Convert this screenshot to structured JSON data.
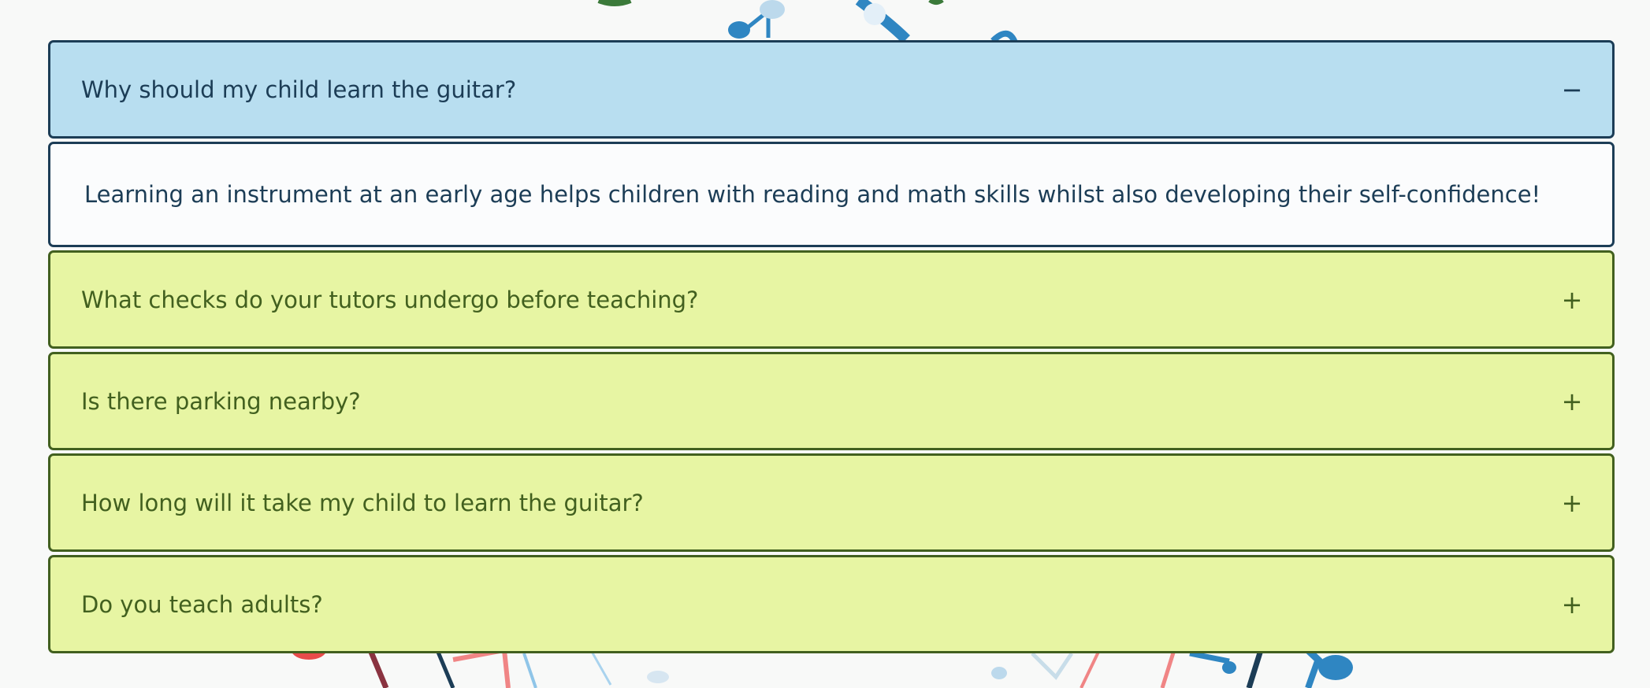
{
  "faq": {
    "items": [
      {
        "question": "Why should my child learn the guitar?",
        "toggle": "−",
        "answer": "Learning an instrument at an early age helps children with reading and math skills whilst also developing their self-confidence!"
      },
      {
        "question": "What checks do your tutors undergo before teaching?",
        "toggle": "+"
      },
      {
        "question": "Is there parking nearby?",
        "toggle": "+"
      },
      {
        "question": "How long will it take my child to learn the guitar?",
        "toggle": "+"
      },
      {
        "question": "Do you teach adults?",
        "toggle": "+"
      }
    ]
  },
  "colors": {
    "open_header_bg": "#b8def0",
    "open_border": "#1c3d56",
    "closed_header_bg": "#e7f5a3",
    "closed_border": "#42601f",
    "page_bg": "#f8f9f8"
  }
}
